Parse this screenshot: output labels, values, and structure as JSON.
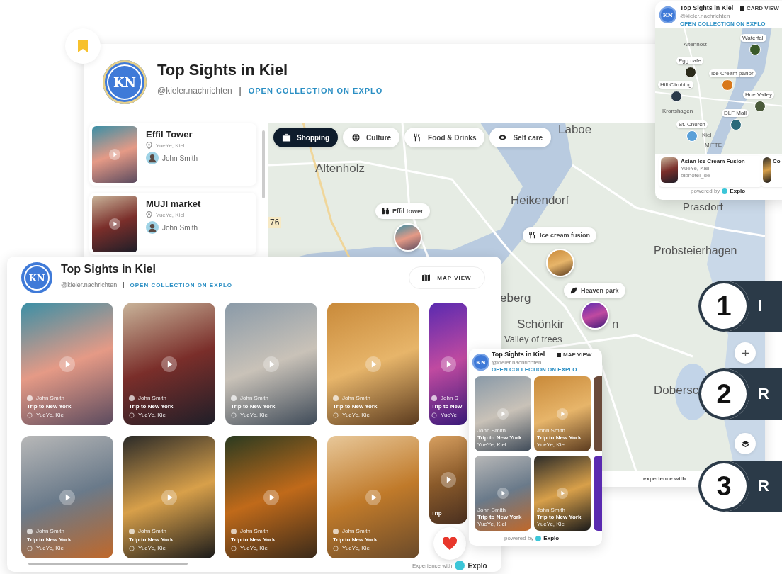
{
  "main_widget": {
    "avatar_initials": "KN",
    "title": "Top Sights in Kiel",
    "handle": "@kieler.nachrichten",
    "separator": "|",
    "link": "OPEN COLLECTION ON EXPLO",
    "places": [
      {
        "name": "Effil Tower",
        "location": "YueYe, Kiel",
        "author": "John Smith"
      },
      {
        "name": "MUJI market",
        "location": "YueYe, Kiel",
        "author": "John Smith"
      }
    ],
    "categories": [
      {
        "label": "Shopping",
        "kind": "shopping",
        "selected": true
      },
      {
        "label": "Culture",
        "kind": "culture",
        "selected": false
      },
      {
        "label": "Food & Drinks",
        "kind": "food",
        "selected": false
      },
      {
        "label": "Self care",
        "kind": "selfcare",
        "selected": false
      }
    ],
    "map_labels": [
      "Laboe",
      "Altenholz",
      "Heikendorf",
      "76",
      "Prasdorf",
      "Probsteierhagen",
      "eberg",
      "Schönkir",
      "n",
      "Valley of trees",
      "Dobersc"
    ],
    "map_pins": [
      {
        "label": "Effil tower",
        "kind": "sight"
      },
      {
        "label": "Ice cream fusion",
        "kind": "food"
      },
      {
        "label": "Heaven park",
        "kind": "park"
      }
    ],
    "footer": "experience with"
  },
  "mini_map_widget": {
    "avatar_initials": "KN",
    "title": "Top Sights in Kiel",
    "handle": "@kieler.nachrichten",
    "link": "OPEN COLLECTION ON EXPLO",
    "view_button": "CARD VIEW",
    "map_labels": [
      "Altenholz",
      "Kronshagen",
      "Kiel",
      "MITTE"
    ],
    "map_pins": [
      "Waterfall",
      "Egg cafe",
      "Ice Cream parlor",
      "Hill Climbing",
      "Hue Valley",
      "DLF Mall",
      "St. Church"
    ],
    "cards": [
      {
        "name": "Asian Ice Cream Fusion",
        "location": "YueYe, Kiel",
        "author": "bibhotel_de"
      },
      {
        "name": "Co"
      }
    ],
    "powered_by": "powered by",
    "brand": "Explo"
  },
  "gallery_widget": {
    "avatar_initials": "KN",
    "title": "Top Sights in Kiel",
    "handle": "@kieler.nachrichten",
    "separator": "|",
    "link": "OPEN COLLECTION ON EXPLO",
    "view_button": "MAP VIEW",
    "cards": [
      {
        "author": "John Smith",
        "title": "Trip to New York",
        "location": "YueYe, Kiel"
      },
      {
        "author": "John Smith",
        "title": "Trip to New York",
        "location": "YueYe, Kiel"
      },
      {
        "author": "John Smith",
        "title": "Trip to New York",
        "location": "YueYe, Kiel"
      },
      {
        "author": "John Smith",
        "title": "Trip to New York",
        "location": "YueYe, Kiel"
      },
      {
        "author": "John S",
        "title": "Trip to New",
        "location": "YueYe"
      },
      {
        "author": "John Smith",
        "title": "Trip to New York",
        "location": "YueYe, Kiel"
      },
      {
        "author": "John Smith",
        "title": "Trip to New York",
        "location": "YueYe, Kiel"
      },
      {
        "author": "John Smith",
        "title": "Trip to New York",
        "location": "YueYe, Kiel"
      },
      {
        "author": "John Smith",
        "title": "Trip to New York",
        "location": "YueYe, Kiel"
      },
      {
        "title": "Trip"
      }
    ],
    "footer": "Experience with",
    "brand": "Explo"
  },
  "mini_gallery_widget": {
    "avatar_initials": "KN",
    "title": "Top Sights in Kiel",
    "handle": "@kieler.nachrichten",
    "link": "OPEN COLLECTION ON EXPLO",
    "view_button": "MAP VIEW",
    "cards": [
      {
        "author": "John Smith",
        "title": "Trip to New York",
        "location": "YueYe, Kiel"
      },
      {
        "author": "John Smith",
        "title": "Trip to New York",
        "location": "YueYe, Kiel"
      },
      {
        "author": "John Smith",
        "title": "Trip to New York",
        "location": "YueYe, Kiel"
      },
      {
        "author": "John Smith",
        "title": "Trip to New York",
        "location": "YueYe, Kiel"
      }
    ],
    "powered_by": "powered by",
    "brand": "Explo"
  },
  "steps": [
    {
      "number": "1",
      "label": "I"
    },
    {
      "number": "2",
      "label": "R"
    },
    {
      "number": "3",
      "label": "R"
    }
  ]
}
